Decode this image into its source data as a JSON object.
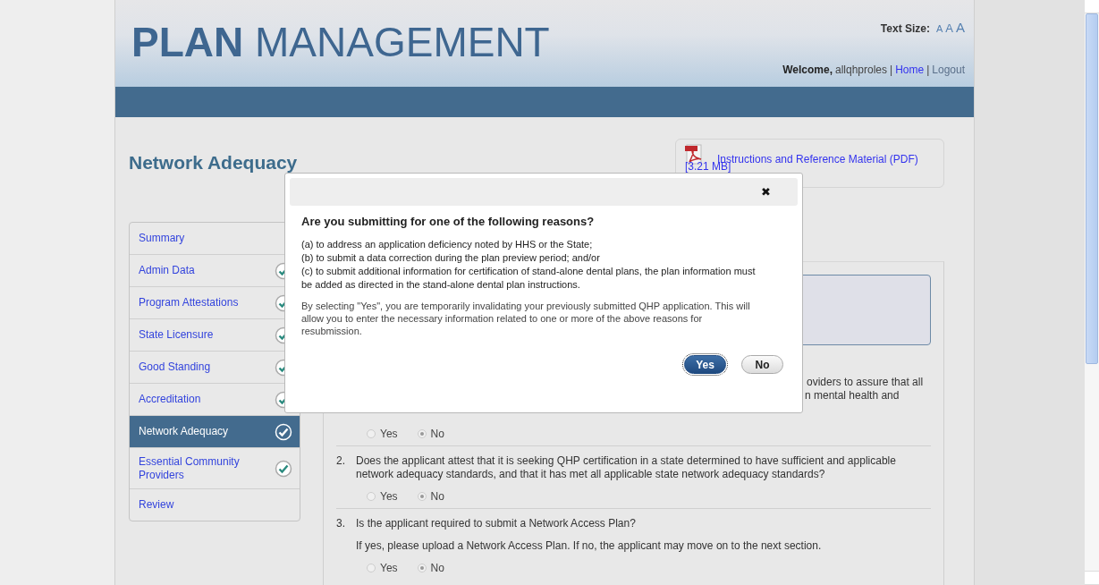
{
  "header": {
    "logo_bold": "PLAN",
    "logo_rest": "MANAGEMENT",
    "text_size_label": "Text Size:",
    "text_size_options": [
      "A",
      "A",
      "A"
    ],
    "welcome_label": "Welcome,",
    "username": "allqhproles",
    "separator": "|",
    "links": [
      "Home",
      "Logout"
    ]
  },
  "page_title": "Network Adequacy",
  "resource_link": {
    "label": "Instructions and Reference Material (PDF)",
    "size": "[3.21 MB]"
  },
  "sidebar": {
    "items": [
      {
        "label": "Summary",
        "completed": false,
        "selected": false
      },
      {
        "label": "Admin Data",
        "completed": true,
        "selected": false
      },
      {
        "label": "Program Attestations",
        "completed": true,
        "selected": false
      },
      {
        "label": "State Licensure",
        "completed": true,
        "selected": false
      },
      {
        "label": "Good Standing",
        "completed": true,
        "selected": false
      },
      {
        "label": "Accreditation",
        "completed": true,
        "selected": false
      },
      {
        "label": "Network Adequacy",
        "completed": true,
        "selected": true
      },
      {
        "label": "Essential Community Providers",
        "completed": true,
        "selected": false
      },
      {
        "label": "Review",
        "completed": false,
        "selected": false
      }
    ]
  },
  "questions": [
    {
      "text_lines": [
        "oviders to assure that all",
        "n mental health and"
      ],
      "options": [
        {
          "label": "Yes",
          "selected": false
        },
        {
          "label": "No",
          "selected": true
        }
      ]
    },
    {
      "number": "2.",
      "text": "Does the applicant attest that it is seeking QHP certification in a state determined to have sufficient and applicable network adequacy standards, and that it has met all applicable state network adequacy standards?",
      "options": [
        {
          "label": "Yes",
          "selected": false
        },
        {
          "label": "No",
          "selected": true
        }
      ]
    },
    {
      "number": "3.",
      "text": "Is the applicant required to submit a Network Access Plan?",
      "note": "If yes, please upload a Network Access Plan. If no, the applicant may move on to the next section.",
      "options": [
        {
          "label": "Yes",
          "selected": false
        },
        {
          "label": "No",
          "selected": true
        }
      ]
    }
  ],
  "modal": {
    "close": "✖",
    "title": "Are you submitting for one of the following reasons?",
    "reasons": [
      "(a) to address an application deficiency noted by HHS or the State;",
      "(b) to submit a data correction during the plan preview period; and/or",
      "(c) to submit additional information for certification of stand-alone dental plans, the plan information must be added as directed in the stand-alone dental plan instructions."
    ],
    "note": "By selecting \"Yes\", you are temporarily invalidating your previously submitted QHP application. This will allow you to enter the necessary information related to one or more of the above reasons for resubmission.",
    "buttons": [
      {
        "label": "Yes",
        "kind": "primary"
      },
      {
        "label": "No",
        "kind": "default"
      }
    ]
  }
}
